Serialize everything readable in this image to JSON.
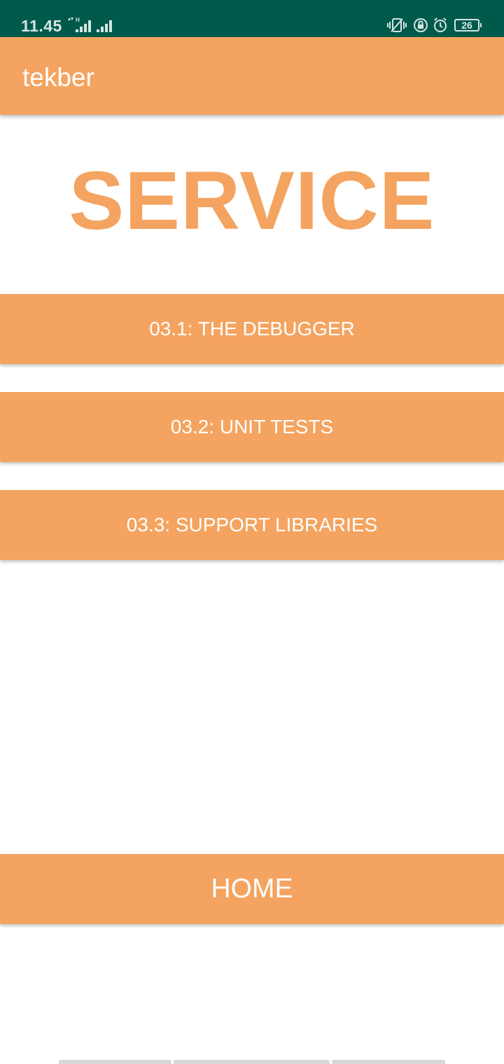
{
  "status_bar": {
    "time": "11.45",
    "battery": "26",
    "color": "#005a4b"
  },
  "app_bar": {
    "title": "tekber",
    "color": "#f4a460"
  },
  "heading": "SERVICE",
  "buttons": {
    "debugger": "03.1: THE DEBUGGER",
    "unit_tests": "03.2: UNIT TESTS",
    "support_libraries": "03.3: SUPPORT LIBRARIES",
    "home": "HOME"
  },
  "icons": {
    "status_left": [
      "data-transfer-icon",
      "signal-h-icon",
      "signal-icon"
    ],
    "status_right": [
      "vibrate-icon",
      "rotation-lock-icon",
      "alarm-icon",
      "battery-icon"
    ]
  }
}
